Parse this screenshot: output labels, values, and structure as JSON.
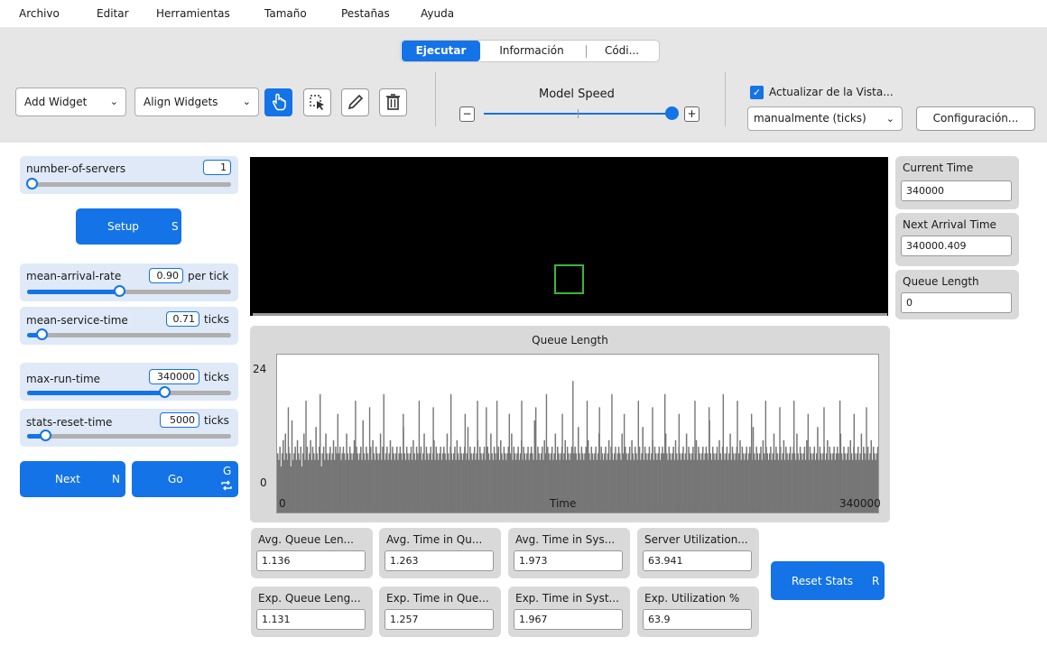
{
  "menu": [
    "Archivo",
    "Editar",
    "Herramientas",
    "Tamaño",
    "Pestañas",
    "Ayuda"
  ],
  "tabs": [
    {
      "label": "Ejecutar",
      "active": true
    },
    {
      "label": "Información",
      "active": false
    },
    {
      "label": "Códi...",
      "active": false
    }
  ],
  "toolbar": {
    "add_widget": "Add Widget",
    "align_widgets": "Align Widgets",
    "tools": [
      {
        "icon": "hand-pointer-icon",
        "active": true
      },
      {
        "icon": "select-box-icon",
        "active": false
      },
      {
        "icon": "pencil-icon",
        "active": false
      },
      {
        "icon": "trash-icon",
        "active": false
      }
    ],
    "model_speed_label": "Model Speed",
    "speed_minus": "−",
    "speed_plus": "+",
    "speed_level": 1.0,
    "update_view_label": "Actualizar de la Vista...",
    "update_view_checked": true,
    "update_mode": "manualmente (ticks)",
    "settings_button": "Configuración..."
  },
  "sliders": [
    {
      "name": "number-of-servers",
      "value": "1",
      "unit": "",
      "level": 0.0
    },
    {
      "name": "mean-arrival-rate",
      "value": "0.90",
      "unit": "per tick",
      "level": 0.45
    },
    {
      "name": "mean-service-time",
      "value": "0.71",
      "unit": "ticks",
      "level": 0.07
    },
    {
      "name": "max-run-time",
      "value": "340000",
      "unit": "ticks",
      "level": 0.67
    },
    {
      "name": "stats-reset-time",
      "value": "5000",
      "unit": "ticks",
      "level": 0.07
    }
  ],
  "buttons": {
    "setup": {
      "label": "Setup",
      "key": "S"
    },
    "next": {
      "label": "Next",
      "key": "N"
    },
    "go": {
      "label": "Go",
      "key": "G",
      "forever_icon": "repeat-icon"
    },
    "reset_stats": {
      "label": "Reset Stats",
      "key": "R"
    }
  },
  "right_monitors": [
    {
      "label": "Current Time",
      "value": "340000"
    },
    {
      "label": "Next Arrival Time",
      "value": "340000.409"
    },
    {
      "label": "Queue Length",
      "value": "0"
    }
  ],
  "stat_monitors": [
    {
      "label": "Avg. Queue Len...",
      "value": "1.136"
    },
    {
      "label": "Avg. Time in Qu...",
      "value": "1.263"
    },
    {
      "label": "Avg. Time in Sys...",
      "value": "1.973"
    },
    {
      "label": "Server Utilization...",
      "value": "63.941"
    },
    {
      "label": "Exp. Queue Leng...",
      "value": "1.131"
    },
    {
      "label": "Exp. Time in Que...",
      "value": "1.257"
    },
    {
      "label": "Exp. Time in Syst...",
      "value": "1.967"
    },
    {
      "label": "Exp. Utilization %",
      "value": "63.9"
    }
  ],
  "colors": {
    "accent": "#1473e6",
    "view_background": "#000000",
    "turtle": "#3cb43c",
    "histogram_bars": "#767676"
  },
  "chart_data": {
    "type": "bar",
    "title": "Queue Length",
    "xlabel": "Time",
    "ylabel": "",
    "x_ticks": [
      "0",
      "340000"
    ],
    "y_ticks": [
      "0",
      "24"
    ],
    "xlim": [
      0,
      340000
    ],
    "ylim": [
      0,
      24
    ],
    "series": [
      {
        "color": "#767676",
        "values": [
          9,
          8,
          10,
          7,
          9,
          11,
          8,
          12,
          9,
          8,
          10,
          9,
          7,
          14,
          8,
          9,
          10,
          8,
          11,
          9,
          8,
          10,
          7,
          9,
          12,
          8,
          9,
          10,
          8,
          9,
          11,
          8,
          10,
          9,
          8,
          13,
          9,
          8,
          10,
          9,
          7,
          9,
          10,
          8,
          12,
          9,
          8,
          9,
          10,
          8,
          9,
          11,
          8,
          10,
          9,
          8,
          9,
          10,
          8,
          9,
          10,
          9,
          8,
          12,
          9,
          8,
          10,
          9,
          8,
          9,
          11,
          8,
          10,
          9,
          8,
          9,
          10,
          8,
          14,
          9,
          8,
          10,
          9,
          8,
          9,
          10,
          8,
          11,
          9,
          8,
          10,
          9,
          8,
          9,
          12,
          8,
          10,
          9,
          8,
          9,
          10,
          8,
          9,
          11,
          8,
          10,
          9,
          8,
          9,
          10,
          8,
          9,
          10,
          9,
          8,
          13,
          9,
          8,
          10,
          9,
          8,
          9,
          10,
          8,
          11,
          9,
          8,
          10,
          9,
          8,
          9,
          10,
          8,
          9,
          12,
          8,
          10,
          9,
          8,
          9,
          10,
          8,
          9,
          11,
          8,
          10,
          9,
          8,
          9,
          10,
          8,
          9,
          10,
          9,
          8,
          12,
          9,
          8,
          10,
          9,
          8,
          9,
          10,
          8,
          11,
          9,
          8,
          10,
          9,
          8,
          9,
          10,
          8,
          9,
          13,
          8,
          10,
          9,
          8,
          9,
          10,
          8,
          9,
          11,
          8,
          10,
          9,
          8,
          9,
          10,
          8,
          9,
          10,
          9,
          8,
          12,
          9,
          8,
          10,
          9,
          8,
          9,
          10,
          8,
          11,
          9,
          8,
          10,
          9,
          8,
          9,
          10,
          8,
          9,
          12,
          8,
          10,
          9,
          8,
          9,
          10,
          8,
          9,
          11,
          8,
          10,
          9,
          8,
          9,
          10,
          8,
          9,
          10,
          9,
          8,
          14,
          9,
          8,
          10,
          9,
          8,
          9,
          10,
          8,
          11,
          9,
          8,
          10,
          9,
          8,
          9,
          10,
          8,
          9,
          12,
          8,
          10,
          9,
          8,
          9,
          10,
          8,
          9,
          11,
          8,
          10,
          9,
          8,
          9,
          10,
          8,
          9,
          10,
          9,
          8,
          13,
          9,
          8,
          10,
          9,
          8,
          9,
          10,
          8,
          11,
          9,
          8,
          10,
          9,
          8,
          9,
          10,
          8,
          9,
          12,
          8,
          10,
          9,
          8,
          9,
          10,
          8,
          9,
          11,
          8,
          10,
          9,
          8,
          9,
          10,
          8,
          9,
          10,
          9,
          8,
          12,
          9,
          8,
          10,
          9,
          8,
          9,
          10,
          8,
          11,
          9,
          8,
          10,
          9,
          8,
          9,
          10,
          8,
          9,
          13,
          8,
          10,
          9,
          8,
          9,
          10,
          8,
          9,
          11,
          8,
          10,
          9,
          8,
          9,
          10,
          8,
          9,
          10,
          9,
          8,
          12,
          9,
          8,
          10,
          9,
          8,
          9,
          10,
          8,
          11,
          9,
          8,
          10,
          9,
          8,
          9,
          10,
          8,
          9,
          12,
          8,
          10,
          9,
          8,
          9,
          10,
          8,
          9,
          11,
          8,
          10,
          9,
          8,
          9,
          10,
          8,
          9,
          10,
          9,
          8,
          14,
          9,
          8,
          10,
          9,
          8,
          9,
          10,
          8,
          11,
          9,
          8,
          10,
          9,
          8,
          9,
          10,
          8,
          9,
          12,
          8,
          10,
          9,
          8,
          9,
          10,
          8,
          9,
          11,
          8,
          10,
          9,
          8,
          9,
          10,
          8,
          9,
          10,
          9,
          8,
          13,
          9,
          8,
          10,
          9,
          8,
          9,
          10,
          8,
          11,
          9,
          8,
          10,
          9,
          8,
          9,
          10,
          8,
          9,
          12,
          8,
          10,
          9,
          8,
          9,
          10,
          8,
          9,
          11,
          8,
          10,
          9,
          8,
          9,
          10,
          8,
          9,
          10,
          9,
          8,
          12,
          9,
          8,
          10,
          9,
          8,
          9,
          10,
          8,
          11,
          9,
          8,
          10,
          9,
          8,
          9,
          10,
          8,
          9,
          13,
          8,
          10,
          9,
          8,
          9,
          10,
          8,
          9,
          11,
          8,
          10,
          9,
          8,
          9,
          10,
          8,
          9,
          10,
          9,
          8,
          12,
          9,
          8,
          10,
          9,
          8,
          9,
          10,
          8,
          11,
          9,
          8,
          10,
          9,
          8,
          9,
          10,
          8,
          9,
          12,
          8,
          10,
          9,
          8,
          9,
          10,
          8,
          9,
          11,
          8,
          10,
          9,
          8,
          9,
          10
        ]
      },
      {
        "color": "#767676",
        "values": [
          0,
          0,
          0,
          0,
          0,
          0,
          0,
          0,
          0,
          0,
          0,
          0,
          0,
          0,
          0,
          0,
          0,
          0,
          0,
          0,
          0,
          0,
          0,
          0,
          0,
          0,
          0,
          0,
          0,
          0,
          0,
          0,
          0,
          0,
          0,
          0,
          0,
          0,
          0,
          0,
          0,
          0,
          0,
          0,
          0,
          0,
          0,
          0,
          0,
          0,
          0,
          0,
          0,
          0,
          0,
          0,
          0,
          0,
          0,
          0,
          0,
          0,
          0,
          0,
          0,
          0,
          0,
          0,
          0,
          0,
          0,
          0,
          0,
          0,
          0,
          0,
          0,
          0,
          0,
          0,
          0,
          0,
          0,
          0,
          0,
          0,
          0,
          0,
          0,
          0,
          0,
          0,
          0,
          0,
          0,
          0,
          0,
          0,
          0,
          0,
          0,
          0,
          0,
          0,
          0,
          0,
          0,
          0,
          0,
          0,
          0,
          0,
          0,
          0,
          0,
          0,
          0,
          0,
          0,
          0,
          0,
          0,
          0,
          0,
          0,
          0,
          0,
          0,
          0,
          0,
          0,
          0,
          0,
          0,
          0,
          0,
          0,
          0,
          0,
          0,
          0,
          0,
          0,
          0,
          0,
          0,
          0,
          0,
          0,
          0,
          0,
          0,
          0,
          0,
          0,
          0,
          0,
          0,
          0,
          0,
          0,
          0,
          0,
          0,
          0,
          0,
          0,
          0,
          0,
          0,
          0,
          0,
          0,
          0,
          0,
          0,
          0,
          0,
          0,
          0,
          0,
          0,
          0,
          0,
          0,
          0,
          0,
          0,
          0,
          0,
          0,
          0,
          0,
          0,
          0,
          0,
          0,
          0,
          0,
          0,
          0,
          0,
          0,
          0,
          0,
          0,
          0,
          0,
          0,
          0,
          0,
          0,
          0,
          0,
          0,
          0,
          0,
          0,
          0,
          0,
          0,
          0,
          0,
          0,
          0,
          0,
          0,
          0,
          0,
          0,
          0,
          0,
          0,
          0,
          0,
          0,
          0,
          0,
          0,
          0,
          0,
          0,
          0,
          0,
          0,
          0,
          0,
          0,
          0,
          0,
          0,
          0,
          0,
          0,
          0,
          0,
          0,
          0,
          0,
          0,
          0,
          0,
          0,
          0,
          0,
          0,
          0,
          0,
          0,
          0,
          0,
          0,
          0,
          0,
          0,
          0,
          0,
          0,
          0,
          0,
          0,
          0,
          0,
          0,
          0,
          0,
          0,
          0,
          0,
          0,
          0,
          0,
          0,
          0,
          0,
          0,
          0,
          0,
          0,
          0,
          0,
          0,
          0,
          0,
          0,
          0,
          0,
          0,
          0,
          0,
          0,
          0,
          0,
          0,
          0,
          0,
          0,
          0,
          0,
          0,
          0,
          0,
          0,
          0,
          0,
          0,
          0,
          0,
          0,
          0,
          0,
          0,
          0,
          0,
          0,
          0,
          0,
          0,
          0,
          0,
          0,
          0,
          0,
          0,
          0,
          0,
          0,
          0,
          0,
          0,
          0,
          0,
          0,
          0,
          0,
          0,
          0,
          0,
          0,
          0,
          0,
          0,
          0,
          0,
          0,
          0,
          0,
          0,
          0,
          0,
          0,
          0,
          0,
          0,
          0,
          0,
          0,
          0,
          0,
          0,
          0,
          0,
          0,
          0,
          0,
          0,
          0,
          0,
          0,
          0,
          0,
          0,
          0,
          0,
          0,
          0,
          0,
          0,
          0,
          0,
          0,
          0,
          0,
          0,
          0,
          0,
          0,
          0,
          0,
          0,
          0,
          0,
          0,
          0,
          0,
          0,
          0,
          0,
          0,
          0,
          0,
          0,
          0,
          0,
          0,
          0,
          0,
          0,
          0,
          0,
          0,
          0,
          0,
          0,
          0,
          0,
          0,
          0,
          0,
          0,
          0,
          0,
          0,
          0,
          0,
          0,
          0,
          0,
          0,
          0,
          0,
          0,
          0,
          0,
          0,
          0,
          0,
          0,
          0,
          0,
          0,
          0,
          0,
          0,
          0,
          0,
          0,
          0,
          0,
          0,
          0,
          0,
          0,
          0,
          0,
          0,
          0,
          0,
          0,
          0,
          0,
          0,
          0,
          0,
          0,
          0,
          0,
          0,
          0,
          0,
          0,
          0,
          0,
          0,
          0,
          0,
          0,
          0,
          0,
          0,
          0,
          0,
          0,
          0,
          0,
          0,
          0,
          0,
          0,
          0,
          0,
          0,
          0,
          0,
          0,
          0,
          0,
          0,
          0
        ]
      }
    ],
    "peaks": [
      {
        "x": 6000,
        "y": 16
      },
      {
        "x": 16000,
        "y": 17
      },
      {
        "x": 24000,
        "y": 18
      },
      {
        "x": 34000,
        "y": 15
      },
      {
        "x": 44000,
        "y": 17
      },
      {
        "x": 52000,
        "y": 16
      },
      {
        "x": 60000,
        "y": 18
      },
      {
        "x": 71000,
        "y": 15
      },
      {
        "x": 80000,
        "y": 17
      },
      {
        "x": 88000,
        "y": 16
      },
      {
        "x": 98000,
        "y": 18
      },
      {
        "x": 106000,
        "y": 15
      },
      {
        "x": 113000,
        "y": 17
      },
      {
        "x": 118000,
        "y": 16
      },
      {
        "x": 124000,
        "y": 17
      },
      {
        "x": 131000,
        "y": 15
      },
      {
        "x": 138000,
        "y": 17
      },
      {
        "x": 146000,
        "y": 16
      },
      {
        "x": 152000,
        "y": 18
      },
      {
        "x": 161000,
        "y": 15
      },
      {
        "x": 167000,
        "y": 20
      },
      {
        "x": 175000,
        "y": 17
      },
      {
        "x": 182000,
        "y": 16
      },
      {
        "x": 189000,
        "y": 18
      },
      {
        "x": 196000,
        "y": 15
      },
      {
        "x": 204000,
        "y": 17
      },
      {
        "x": 212000,
        "y": 16
      },
      {
        "x": 219000,
        "y": 18
      },
      {
        "x": 227000,
        "y": 15
      },
      {
        "x": 236000,
        "y": 17
      },
      {
        "x": 244000,
        "y": 16
      },
      {
        "x": 252000,
        "y": 18
      },
      {
        "x": 260000,
        "y": 17
      },
      {
        "x": 268000,
        "y": 15
      },
      {
        "x": 276000,
        "y": 17
      },
      {
        "x": 284000,
        "y": 16
      },
      {
        "x": 292000,
        "y": 17
      },
      {
        "x": 300000,
        "y": 15
      },
      {
        "x": 309000,
        "y": 16
      },
      {
        "x": 318000,
        "y": 17
      },
      {
        "x": 326000,
        "y": 15
      },
      {
        "x": 333000,
        "y": 16
      }
    ],
    "grid": false
  }
}
